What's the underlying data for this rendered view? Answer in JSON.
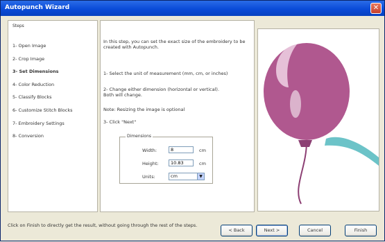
{
  "window": {
    "title": "Autopunch Wizard"
  },
  "steps": {
    "caption": "Steps",
    "items": [
      {
        "label": "1- Open Image",
        "active": false
      },
      {
        "label": "2- Crop Image",
        "active": false
      },
      {
        "label": "3- Set Dimensions",
        "active": true
      },
      {
        "label": "4- Color Reduction",
        "active": false
      },
      {
        "label": "5- Classify Blocks",
        "active": false
      },
      {
        "label": "6- Customize Stitch Blocks",
        "active": false
      },
      {
        "label": "7- Embroidery Settings",
        "active": false
      },
      {
        "label": "8- Conversion",
        "active": false
      }
    ]
  },
  "content": {
    "intro": "In this step, you can set the exact size of the embroidery to be created with Autopunch.",
    "step1": "1- Select the unit of measurement (mm, cm, or inches)",
    "step2": "2- Change either dimension (horizontal or vertical). Both will change.",
    "note": "Note: Resizing the image is optional",
    "step3": "3- Click \"Next\"",
    "dimensions": {
      "caption": "Dimensions",
      "width_label": "Width:",
      "width_value": "8",
      "width_unit": "cm",
      "height_label": "Height:",
      "height_value": "10.83",
      "height_unit": "cm",
      "units_label": "Units:",
      "units_value": "cm"
    }
  },
  "footer": {
    "hint": "Click on Finish to directly get the result, without going through the rest of the steps.",
    "back_label": "< Back",
    "next_label": "Next >",
    "cancel_label": "Cancel",
    "finish_label": "Finish"
  },
  "colors": {
    "balloon": "#b0588f",
    "ribbon": "#6cc3c8",
    "titlebar": "#0a4bd8"
  }
}
